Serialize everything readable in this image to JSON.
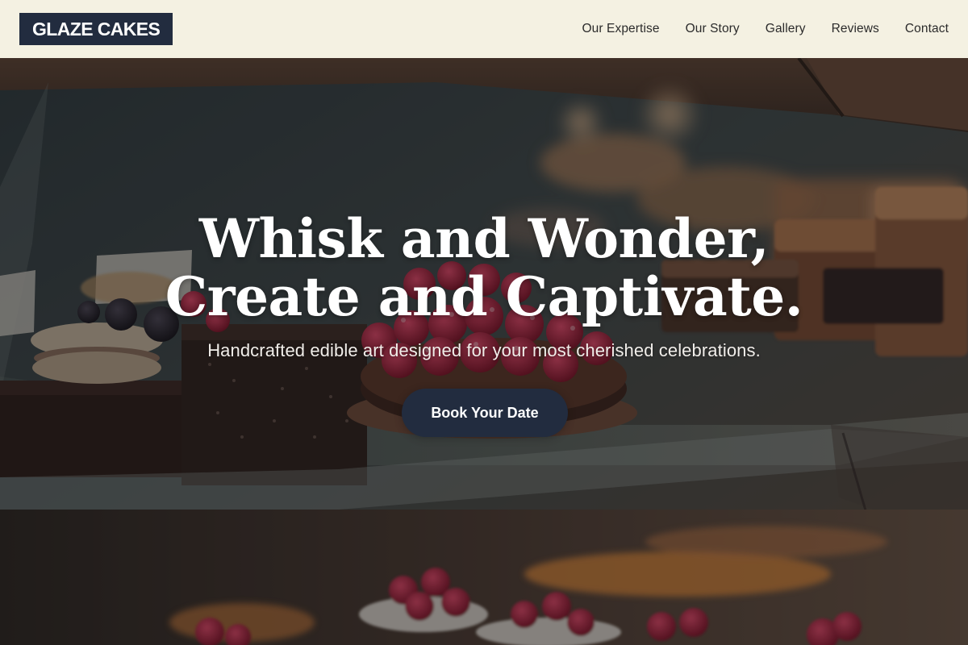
{
  "header": {
    "brand": "GLAZE CAKES",
    "nav": [
      {
        "label": "Our Expertise"
      },
      {
        "label": "Our Story"
      },
      {
        "label": "Gallery"
      },
      {
        "label": "Reviews"
      },
      {
        "label": "Contact"
      }
    ]
  },
  "hero": {
    "headline_line1": "Whisk and Wonder,",
    "headline_line2": "Create and Captivate.",
    "tagline": "Handcrafted edible art designed for your most cherished celebrations.",
    "cta_label": "Book Your Date",
    "background": "photo of a bakery display case with tarts and raspberry cakes"
  },
  "colors": {
    "header_bg": "#f4f1e2",
    "brand_bg": "#222c3f",
    "cta_bg": "#222c3f",
    "text_light": "#ffffff"
  }
}
